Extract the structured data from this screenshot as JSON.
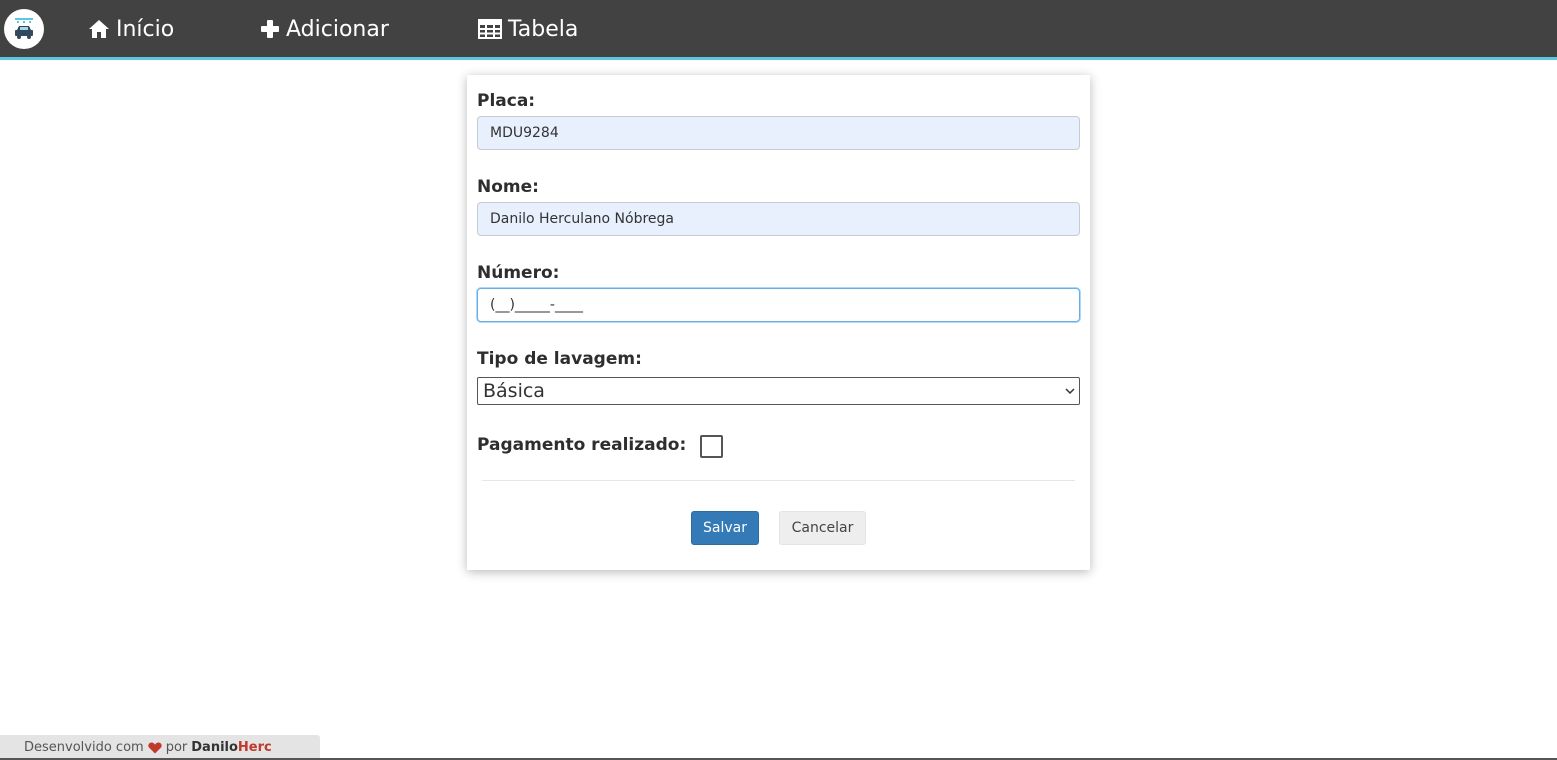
{
  "nav": {
    "logo_icon": "car-wash-icon",
    "items": [
      {
        "label": "Início",
        "icon": "home-icon"
      },
      {
        "label": "Adicionar",
        "icon": "plus-icon"
      },
      {
        "label": "Tabela",
        "icon": "table-icon"
      }
    ]
  },
  "form": {
    "placa_label": "Placa:",
    "placa_value": "MDU9284",
    "nome_label": "Nome:",
    "nome_value": "Danilo Herculano Nóbrega",
    "numero_label": "Número:",
    "numero_value": "(__)_____-____",
    "tipo_label": "Tipo de lavagem:",
    "tipo_selected": "Básica",
    "pagamento_label": "Pagamento realizado:",
    "pagamento_checked": false,
    "save_label": "Salvar",
    "cancel_label": "Cancelar"
  },
  "footer": {
    "prefix": "Desenvolvido com",
    "por": "por",
    "author_main": "Danilo",
    "author_accent": "Herc"
  },
  "colors": {
    "navbar": "#424242",
    "navbar_accent": "#5bc8dc",
    "primary_button": "#337ab7",
    "heart": "#c0392b"
  }
}
